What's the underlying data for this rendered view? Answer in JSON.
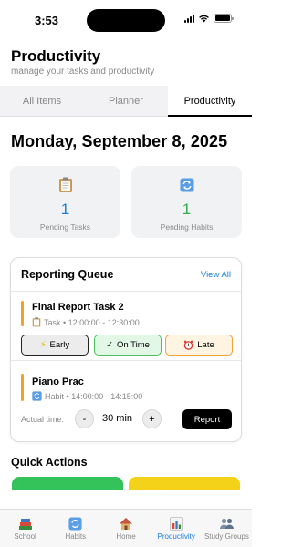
{
  "status_bar": {
    "time": "3:53",
    "battery_level": 1.0
  },
  "header": {
    "title": "Productivity",
    "subtitle": "manage your tasks and productivity"
  },
  "tabs": [
    {
      "label": "All Items",
      "active": false
    },
    {
      "label": "Planner",
      "active": false
    },
    {
      "label": "Productivity",
      "active": true
    }
  ],
  "date_heading": "Monday, September 8, 2025",
  "stats": [
    {
      "value": "1",
      "label": "Pending Tasks",
      "icon": "clipboard-icon",
      "color": "#1a7ee0"
    },
    {
      "value": "1",
      "label": "Pending Habits",
      "icon": "refresh-icon",
      "color": "#2fae4a"
    }
  ],
  "queue": {
    "title": "Reporting Queue",
    "view_all": "View All",
    "items": [
      {
        "title": "Final Report Task 2",
        "meta": "Task • 12:00:00 - 12:30:00",
        "icon": "clipboard-icon",
        "buttons": [
          {
            "label": "Early",
            "icon": "lightning-icon"
          },
          {
            "label": "On Time",
            "icon": "check-icon"
          },
          {
            "label": "Late",
            "icon": "alarm-clock-icon"
          }
        ]
      },
      {
        "title": "Piano Prac",
        "meta": "Habit • 14:00:00 - 14:15:00",
        "icon": "refresh-icon",
        "actual_time_label": "Actual time:",
        "minus": "-",
        "plus": "+",
        "actual_time_value": "30 min",
        "report_label": "Report"
      }
    ]
  },
  "quick_actions": {
    "title": "Quick Actions",
    "tile_colors": [
      "#34c35a",
      "#f5d21a"
    ]
  },
  "bottom_nav": [
    {
      "label": "School",
      "icon": "books-icon",
      "active": false
    },
    {
      "label": "Habits",
      "icon": "refresh-icon",
      "active": false
    },
    {
      "label": "Home",
      "icon": "house-icon",
      "active": false
    },
    {
      "label": "Productivity",
      "icon": "bar-chart-icon",
      "active": true
    },
    {
      "label": "Study Groups",
      "icon": "people-icon",
      "active": false
    }
  ],
  "colors": {
    "accent": "#1a7ee0",
    "queue_accent": "#f2a22b"
  }
}
